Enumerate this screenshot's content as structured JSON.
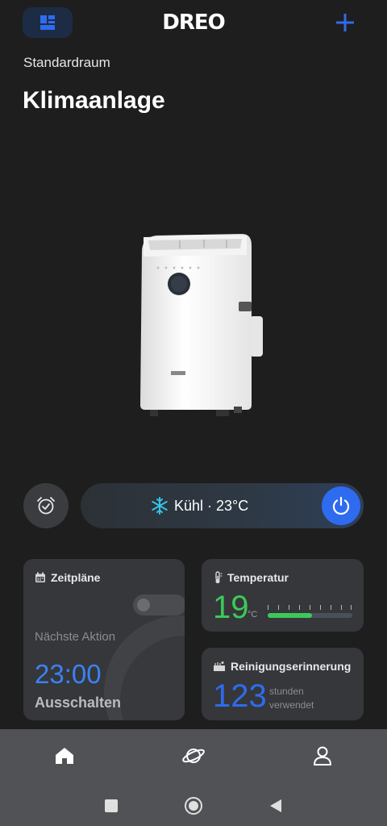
{
  "header": {
    "brand": "DREO"
  },
  "room": "Standardraum",
  "device": {
    "title": "Klimaanlage"
  },
  "mode": {
    "icon": "snowflake-icon",
    "label": "Kühl · 23°C",
    "power_color": "#2f6bef"
  },
  "cards": {
    "schedule": {
      "title": "Zeitpläne",
      "next_label": "Nächste Aktion",
      "time": "23:00",
      "action": "Ausschalten"
    },
    "temperature": {
      "title": "Temperatur",
      "value": "19",
      "unit": "°C",
      "level": 0.52,
      "color": "#3cc95a"
    },
    "cleaning": {
      "title": "Reinigungserinnerung",
      "value": "123",
      "unit_line1": "stunden",
      "unit_line2": "verwendet",
      "color": "#2f6bef"
    }
  },
  "nav": {
    "items": [
      "home-icon",
      "planet-icon",
      "user-icon"
    ],
    "active": "home-icon"
  },
  "colors": {
    "accent": "#2f6bef",
    "background": "#1e1e1e",
    "card": "#35373b"
  }
}
